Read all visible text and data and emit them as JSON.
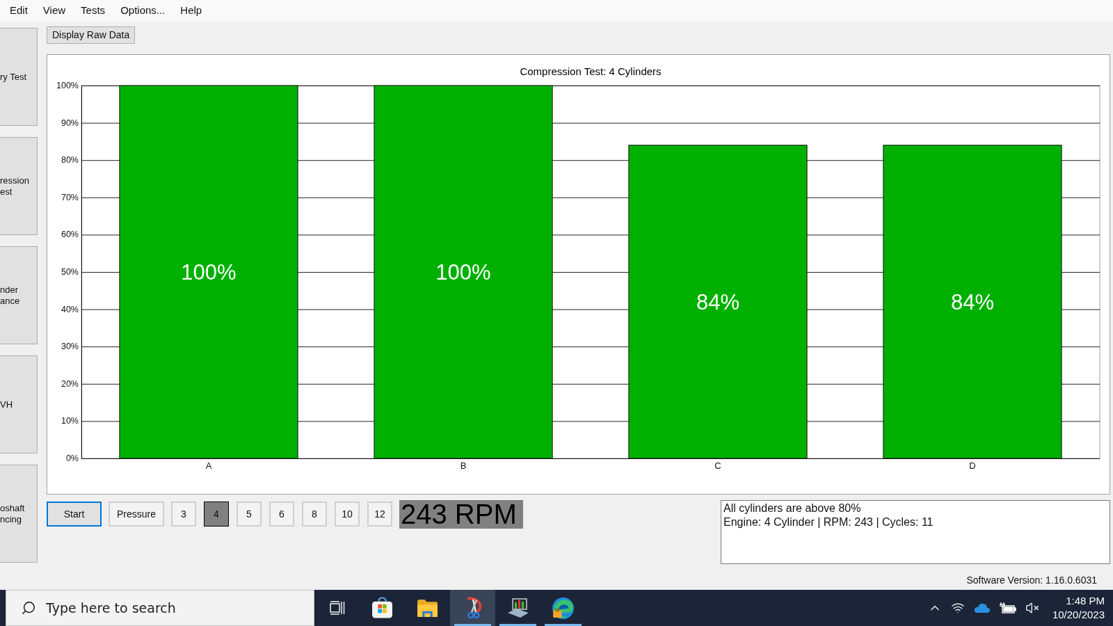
{
  "menu": [
    "Edit",
    "View",
    "Tests",
    "Options...",
    "Help"
  ],
  "sidebar": {
    "buttons": [
      {
        "lines": [
          "ry Test"
        ]
      },
      {
        "lines": [
          "ression",
          "est"
        ]
      },
      {
        "lines": [
          "nder",
          "ance"
        ]
      },
      {
        "lines": [
          "VH"
        ]
      },
      {
        "lines": [
          "oshaft",
          "ncing"
        ]
      }
    ]
  },
  "toolbar": {
    "button": "Display Raw Data"
  },
  "chart": {
    "chart_data": {
      "type": "bar",
      "title": "Compression Test: 4 Cylinders",
      "categories": [
        "A",
        "B",
        "C",
        "D"
      ],
      "series": [
        {
          "color": "#00b000",
          "values": [
            100,
            100,
            84,
            84
          ]
        }
      ],
      "ylim": [
        0,
        100
      ],
      "yticks": [
        {
          "value": 0,
          "label": "0%"
        },
        {
          "value": 10,
          "label": "10%"
        },
        {
          "value": 20,
          "label": "20%"
        },
        {
          "value": 30,
          "label": "30%"
        },
        {
          "value": 40,
          "label": "40%"
        },
        {
          "value": 50,
          "label": "50%"
        },
        {
          "value": 60,
          "label": "60%"
        },
        {
          "value": 70,
          "label": "70%"
        },
        {
          "value": 80,
          "label": "80%"
        },
        {
          "value": 90,
          "label": "90%"
        },
        {
          "value": 100,
          "label": "100%"
        }
      ],
      "grid": true,
      "value_labels": [
        "100%",
        "100%",
        "84%",
        "84%"
      ]
    }
  },
  "controls": {
    "start": {
      "label": "Start",
      "focused": true
    },
    "mode": {
      "label": "Pressure"
    },
    "cylinder_buttons": [
      {
        "label": "3",
        "selected": false
      },
      {
        "label": "4",
        "selected": true
      },
      {
        "label": "5",
        "selected": false
      },
      {
        "label": "6",
        "selected": false
      },
      {
        "label": "8",
        "selected": false
      },
      {
        "label": "10",
        "selected": false
      },
      {
        "label": "12",
        "selected": false
      }
    ],
    "rpm_display": "243 RPM"
  },
  "message_box": {
    "lines": [
      "All cylinders are above 80%",
      "Engine: 4 Cylinder | RPM: 243 | Cycles: 11"
    ]
  },
  "status_bar": {
    "version": "Software Version: 1.16.0.6031"
  },
  "taskbar": {
    "search": {
      "placeholder": "Type here to search"
    },
    "buttons": [
      {
        "kind": "task-view",
        "selected": false,
        "running": false
      },
      {
        "kind": "store",
        "selected": false,
        "running": false
      },
      {
        "kind": "folder",
        "selected": false,
        "running": false
      },
      {
        "kind": "scissors",
        "selected": true,
        "running": true
      },
      {
        "kind": "monitor",
        "selected": false,
        "running": true
      },
      {
        "kind": "browser",
        "selected": false,
        "running": true
      }
    ],
    "time": "1:48 PM",
    "date": "10/20/2023"
  }
}
